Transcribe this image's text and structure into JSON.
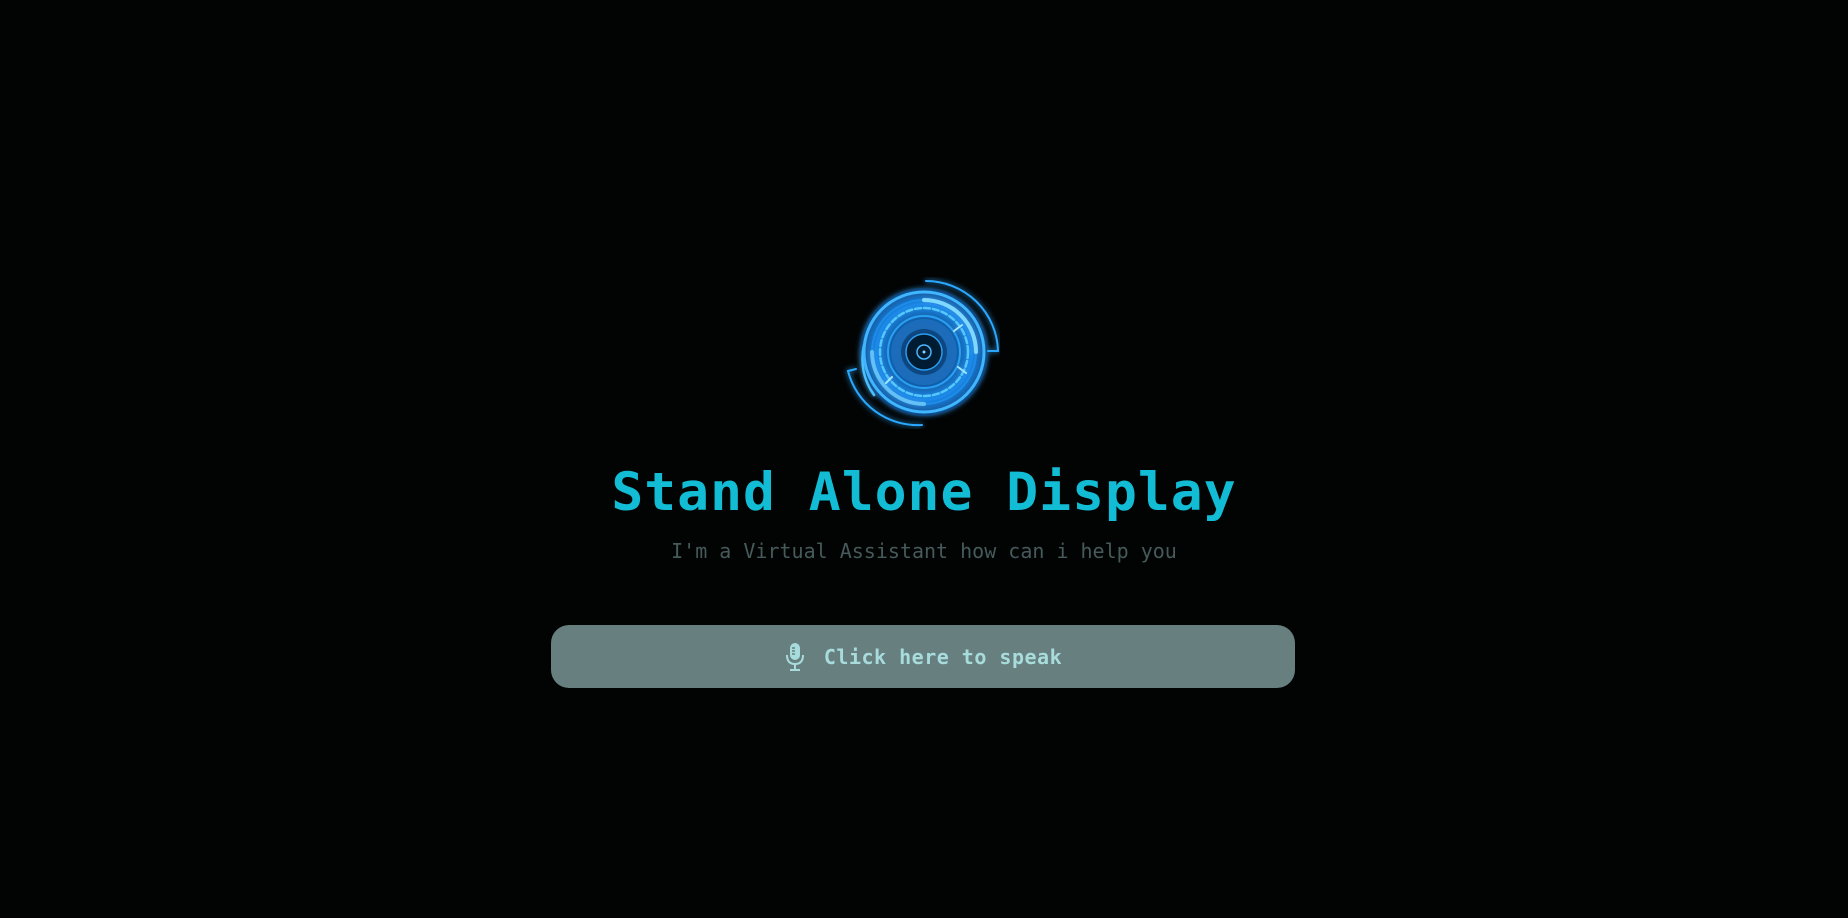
{
  "header": {
    "logo_icon": "hud-circle-icon",
    "title": "Stand Alone Display",
    "subtitle": "I'm a Virtual Assistant how can i help you"
  },
  "speak_button": {
    "icon": "microphone-icon",
    "label": "Click here to speak"
  },
  "colors": {
    "background": "#020303",
    "accent": "#12bcd4",
    "subtitle": "#465a5b",
    "button_bg": "#677f7f",
    "button_text": "#a8dcdc",
    "logo_glow": "#1e9bff"
  }
}
